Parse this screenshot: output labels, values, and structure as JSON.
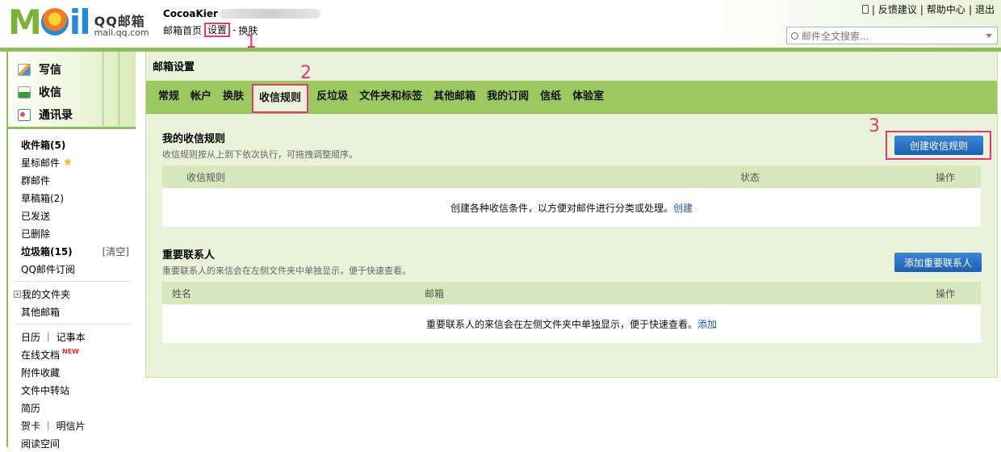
{
  "header": {
    "logo_text": "M",
    "logo_tail": "il",
    "brand_cn": "QQ邮箱",
    "brand_en": "mail.qq.com",
    "account_name": "CocoaKier",
    "nav": [
      "邮箱首页",
      "设置",
      "换肤"
    ],
    "nav_sep": "-",
    "top_links": [
      "反馈建议",
      "帮助中心",
      "退出"
    ],
    "search_placeholder": "邮件全文搜索..."
  },
  "annotations": [
    "1",
    "2",
    "3"
  ],
  "sidebar": {
    "quick": [
      "写信",
      "收信",
      "通讯录"
    ],
    "folders": [
      {
        "label": "收件箱(5)",
        "bold": true
      },
      {
        "label": "星标邮件",
        "star": "★"
      },
      {
        "label": "群邮件"
      },
      {
        "label": "草稿箱(2)"
      },
      {
        "label": "已发送"
      },
      {
        "label": "已删除"
      },
      {
        "label": "垃圾箱(15)",
        "bold": true,
        "extra": "[清空]"
      },
      {
        "label": "QQ邮件订阅"
      }
    ],
    "my_folders": "我的文件夹",
    "other_mail": "其他邮箱",
    "tools": [
      {
        "label": "日历 ｜ 记事本"
      },
      {
        "label": "在线文档",
        "badge": "NEW"
      },
      {
        "label": "附件收藏"
      },
      {
        "label": "文件中转站"
      },
      {
        "label": "简历"
      },
      {
        "label": "贺卡 ｜ 明信片"
      },
      {
        "label": "阅读空间"
      }
    ]
  },
  "main": {
    "title": "邮箱设置",
    "tabs": [
      "常规",
      "帐户",
      "换肤",
      "收信规则",
      "反垃圾",
      "文件夹和标签",
      "其他邮箱",
      "我的订阅",
      "信纸",
      "体验室"
    ],
    "active_tab": "收信规则",
    "rules": {
      "title": "我的收信规则",
      "desc": "收信规则按从上到下依次执行，可拖拽调整顺序。",
      "button": "创建收信规则",
      "columns": [
        "收信规则",
        "状态",
        "操作"
      ],
      "empty_text": "创建各种收信条件，以方便对邮件进行分类或处理。",
      "empty_link": "创建"
    },
    "vip": {
      "title": "重要联系人",
      "desc": "重要联系人的来信会在左侧文件夹中单独显示，便于快速查看。",
      "button": "添加重要联系人",
      "columns": [
        "姓名",
        "邮箱",
        "操作"
      ],
      "empty_text": "重要联系人的来信会在左侧文件夹中单独显示，便于快速查看。",
      "empty_link": "添加"
    }
  },
  "colors": {
    "accent": "#8ebe5a",
    "tabbar": "#9cc862",
    "panel": "#eaf3d9",
    "highlight": "#e23a78",
    "button": "#1a5fb3"
  }
}
